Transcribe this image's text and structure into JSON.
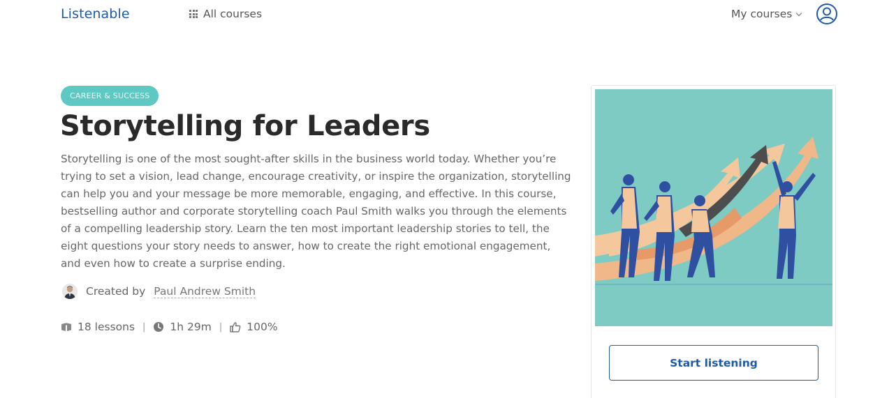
{
  "header": {
    "logo": "Listenable",
    "all_courses": "All courses",
    "my_courses": "My courses"
  },
  "course": {
    "category": "CAREER & SUCCESS",
    "title": "Storytelling for Leaders",
    "description": "Storytelling is one of the most sought-after skills in the business world today. Whether you’re trying to set a vision, lead change, encourage creativity, or inspire the organization, storytelling can help you and your message be more memorable, engaging, and effective. In this course, bestselling author and corporate storytelling coach Paul Smith walks you through the elements of a compelling leadership story. Learn the ten most important leadership stories to tell, the eight questions your story needs to answer, how to create the right emotional engagement, and even how to create a surprise ending.",
    "created_by_label": "Created by",
    "author": "Paul Andrew Smith",
    "lessons": "18 lessons",
    "duration": "1h 29m",
    "rating": "100%"
  },
  "card": {
    "start_button": "Start listening"
  },
  "colors": {
    "brand": "#1e5aa8",
    "badge": "#5ec8c3",
    "cover_bg": "#7ecbc3"
  },
  "icons": [
    "grid-icon",
    "chevron-down-icon",
    "user-icon",
    "book-icon",
    "clock-icon",
    "thumbs-up-icon"
  ]
}
